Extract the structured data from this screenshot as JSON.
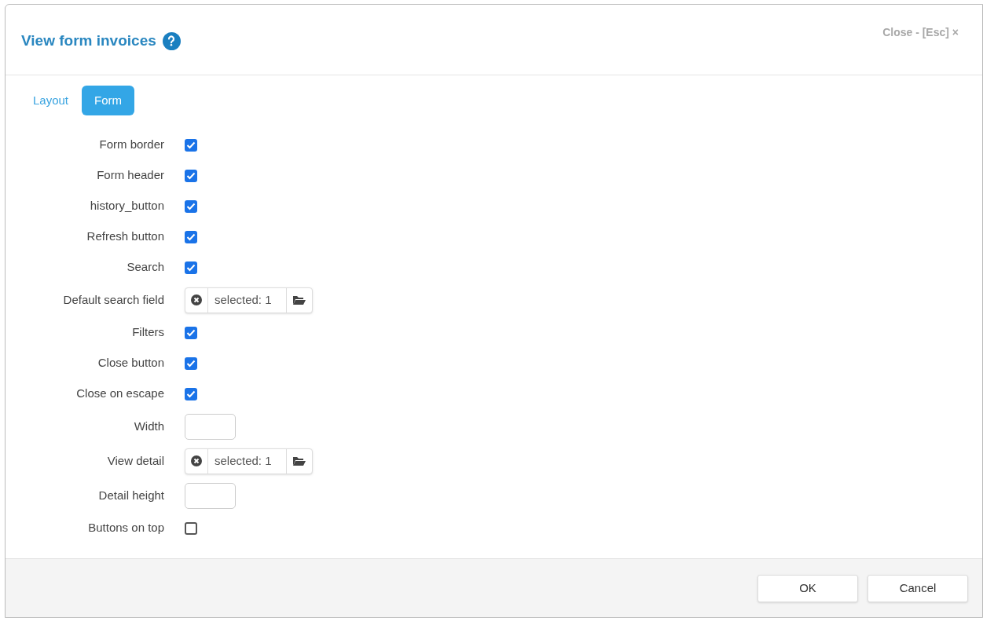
{
  "dialog": {
    "title": "View form invoices",
    "close_label": "Close - [Esc] ×"
  },
  "tabs": [
    {
      "label": "Layout",
      "selected": false
    },
    {
      "label": "Form",
      "selected": true
    }
  ],
  "fields": [
    {
      "kind": "checkbox",
      "label": "Form border",
      "checked": true
    },
    {
      "kind": "checkbox",
      "label": "Form header",
      "checked": true
    },
    {
      "kind": "checkbox",
      "label": "history_button",
      "checked": true
    },
    {
      "kind": "checkbox",
      "label": "Refresh button",
      "checked": true
    },
    {
      "kind": "checkbox",
      "label": "Search",
      "checked": true
    },
    {
      "kind": "selector",
      "label": "Default search field",
      "value": "selected: 1"
    },
    {
      "kind": "checkbox",
      "label": "Filters",
      "checked": true
    },
    {
      "kind": "checkbox",
      "label": "Close button",
      "checked": true
    },
    {
      "kind": "checkbox",
      "label": "Close on escape",
      "checked": true
    },
    {
      "kind": "text",
      "label": "Width"
    },
    {
      "kind": "selector",
      "label": "View detail",
      "value": "selected: 1"
    },
    {
      "kind": "text",
      "label": "Detail height"
    },
    {
      "kind": "checkbox",
      "label": "Buttons on top",
      "checked": false
    }
  ],
  "buttons": [
    "OK",
    "Cancel"
  ]
}
